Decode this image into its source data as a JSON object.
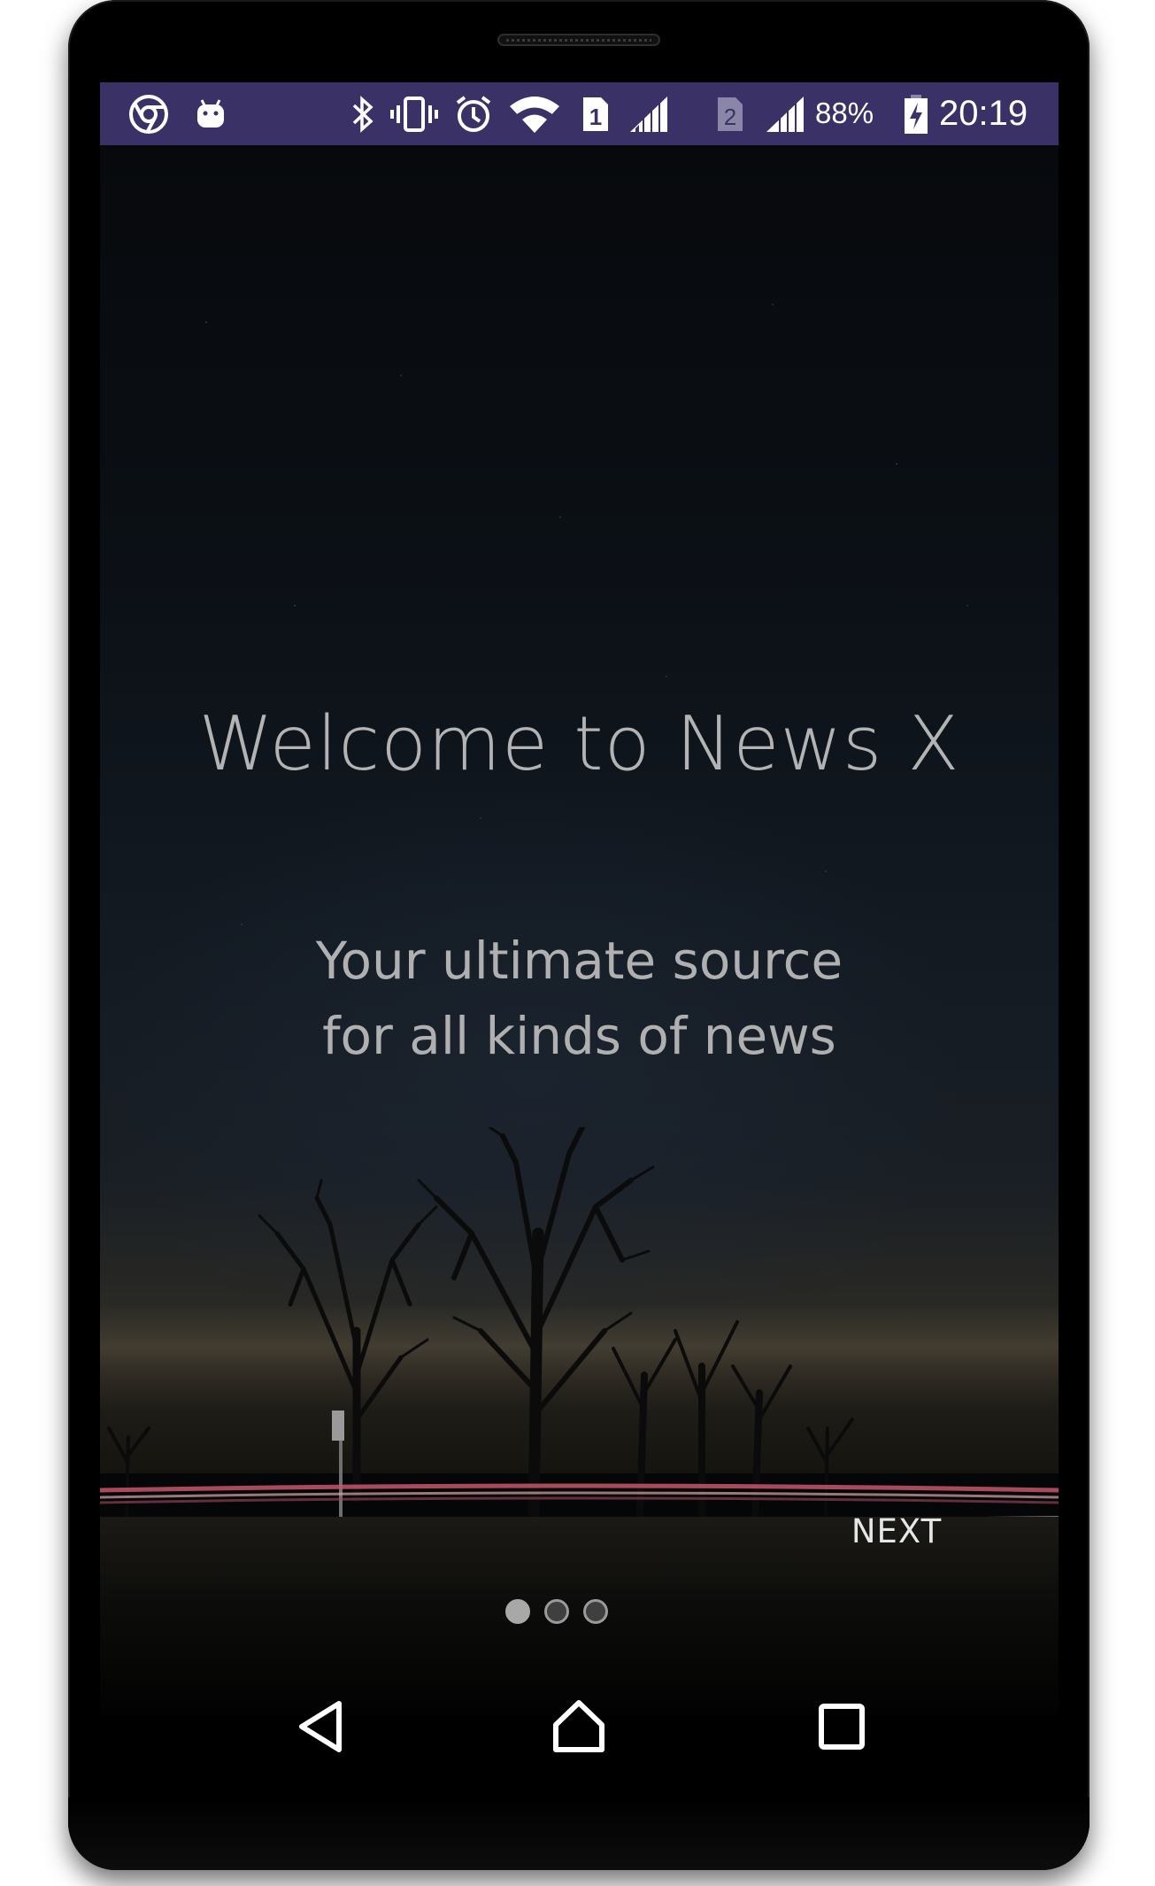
{
  "status_bar": {
    "background": "#3a3166",
    "left_icons": [
      "chrome-icon",
      "android-icon"
    ],
    "right_icons": [
      "bluetooth-icon",
      "vibrate-icon",
      "alarm-icon",
      "wifi-icon",
      "sim1-icon",
      "signal-icon",
      "sim2-icon",
      "signal-icon",
      "battery-charging-icon"
    ],
    "sim1_label": "1",
    "sim2_label": "2",
    "battery_percent": "88%",
    "time": "20:19"
  },
  "onboarding": {
    "title": "Welcome to News X",
    "subtitle": "Your ultimate source for all kinds of news",
    "next_label": "NEXT",
    "page_indicator": {
      "total": 3,
      "current": 1
    }
  },
  "nav_bar": {
    "buttons": [
      "back-icon",
      "home-icon",
      "recents-icon"
    ]
  }
}
